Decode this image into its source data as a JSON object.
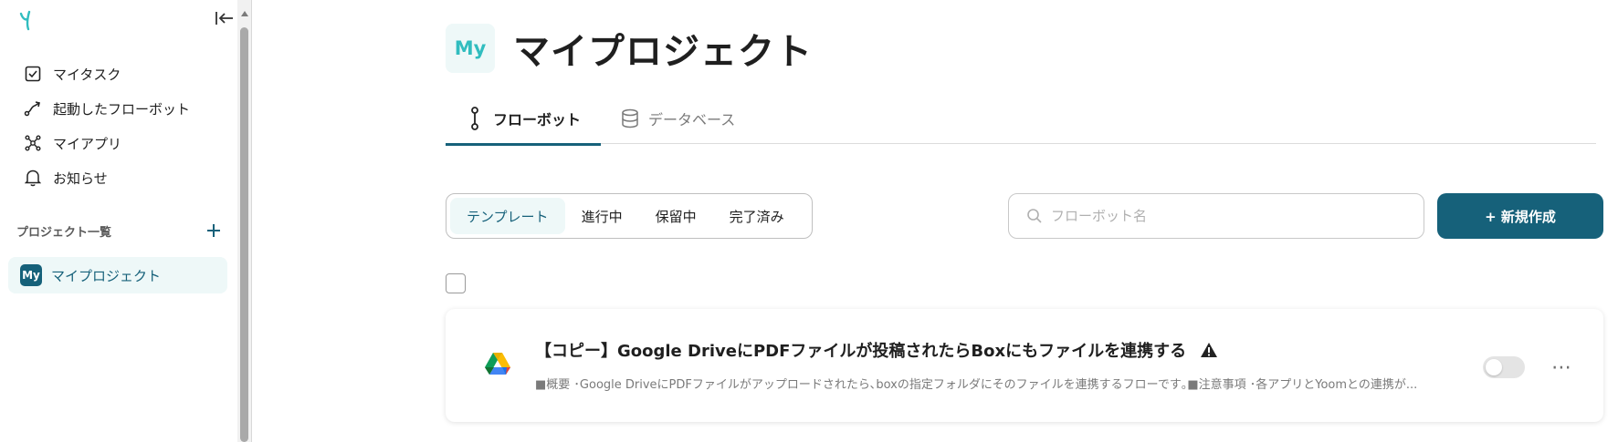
{
  "sidebar": {
    "nav": [
      {
        "label": "マイタスク",
        "icon": "checkbox-icon"
      },
      {
        "label": "起動したフローボット",
        "icon": "flow-arrow-icon"
      },
      {
        "label": "マイアプリ",
        "icon": "app-network-icon"
      },
      {
        "label": "お知らせ",
        "icon": "bell-icon"
      }
    ],
    "section_label": "プロジェクト一覧",
    "project": {
      "badge": "My",
      "label": "マイプロジェクト"
    }
  },
  "page": {
    "badge": "My",
    "title": "マイプロジェクト",
    "tabs": [
      {
        "label": "フローボット",
        "icon": "flowbot-icon",
        "active": true
      },
      {
        "label": "データベース",
        "icon": "database-icon",
        "active": false
      }
    ]
  },
  "filters": [
    {
      "label": "テンプレート",
      "active": true
    },
    {
      "label": "進行中",
      "active": false
    },
    {
      "label": "保留中",
      "active": false
    },
    {
      "label": "完了済み",
      "active": false
    }
  ],
  "search": {
    "placeholder": "フローボット名"
  },
  "new_button": {
    "label": "+ 新規作成"
  },
  "flows": [
    {
      "title": "【コピー】Google DriveにPDFファイルが投稿されたらBoxにもファイルを連携する",
      "description": "■概要 ･Google DriveにPDFファイルがアップロードされたら､boxの指定フォルダにそのファイルを連携するフローです｡■注意事項 ･各アプリとYoomとの連携が...",
      "app_icon": "google-drive-icon",
      "warning": true,
      "enabled": false
    }
  ],
  "colors": {
    "accent": "#16617a",
    "accent_light": "#eef8f8",
    "badge_text": "#31bdbf"
  }
}
